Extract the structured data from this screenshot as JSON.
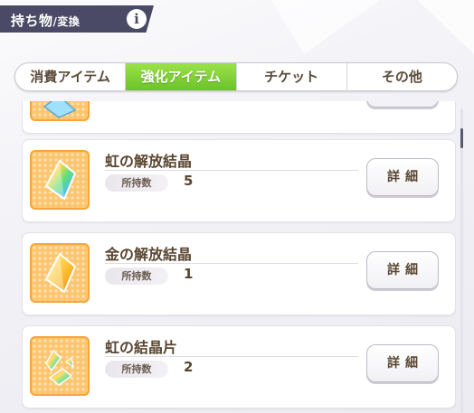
{
  "header": {
    "title_main": "持ち物",
    "title_sub": "/変換",
    "info_glyph": "i"
  },
  "tabs": [
    {
      "label": "消費アイテム",
      "active": false
    },
    {
      "label": "強化アイテム",
      "active": true
    },
    {
      "label": "チケット",
      "active": false
    },
    {
      "label": "その他",
      "active": false
    }
  ],
  "items": [
    {
      "name": "虹の解放結晶",
      "qty_label": "所持数",
      "qty": "5",
      "button": "詳細",
      "icon": "rainbow-crystal-icon"
    },
    {
      "name": "金の解放結晶",
      "qty_label": "所持数",
      "qty": "1",
      "button": "詳細",
      "icon": "gold-crystal-icon"
    },
    {
      "name": "虹の結晶片",
      "qty_label": "所持数",
      "qty": "2",
      "button": "詳細",
      "icon": "rainbow-shard-icon"
    }
  ],
  "colors": {
    "header_bg": "#4b4a66",
    "active_tab": "#7fd035",
    "icon_bg": "#fcc56f",
    "text": "#5a4630"
  }
}
